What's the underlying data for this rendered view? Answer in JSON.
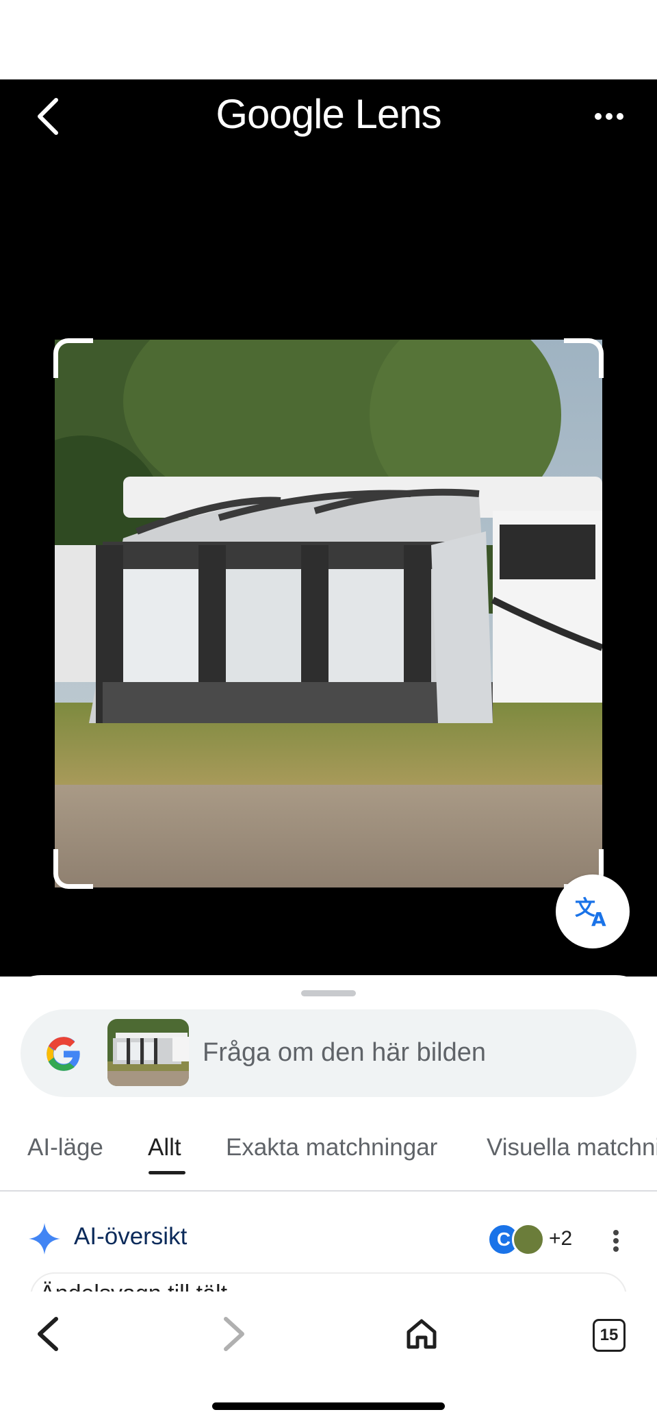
{
  "header": {
    "title_brand": "Google",
    "title_product": "Lens",
    "back_icon": "chevron-left-icon",
    "more_icon": "more-horizontal-icon"
  },
  "image": {
    "subject": "awning-tent-photo"
  },
  "translate_button": {
    "icon": "translate-icon"
  },
  "search": {
    "placeholder": "Fråga om den här bilden",
    "logo": "google-g-icon"
  },
  "tabs": [
    {
      "label": "AI-läge",
      "active": false
    },
    {
      "label": "Allt",
      "active": true
    },
    {
      "label": "Exakta matchningar",
      "active": false
    },
    {
      "label": "Visuella matchningar",
      "active": false
    }
  ],
  "ai_overview": {
    "title": "AI-översikt",
    "avatar_letter": "C",
    "more_sources": "+2",
    "preview_text": "Ändelsvagn till tält"
  },
  "browser_nav": {
    "tabs_count": "15"
  },
  "colors": {
    "header_bg": "#000000",
    "accent_blue": "#1a73e8",
    "ai_title": "#0b2a5a",
    "pill_bg": "#f0f3f4"
  }
}
